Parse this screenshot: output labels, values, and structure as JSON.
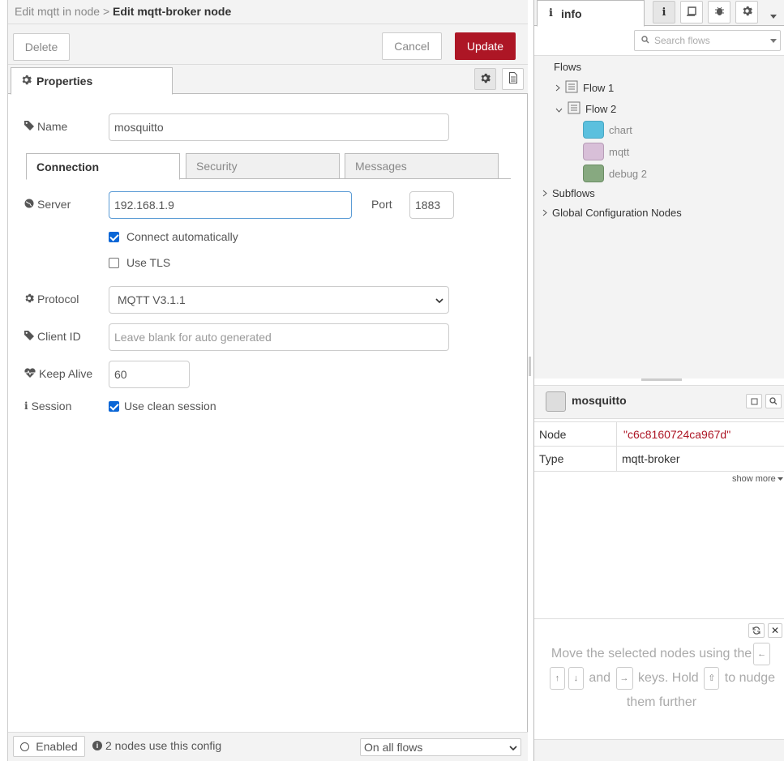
{
  "editor": {
    "breadcrumb_parent": "Edit mqtt in node",
    "breadcrumb_sep": ">",
    "title": "Edit mqtt-broker node",
    "delete_label": "Delete",
    "cancel_label": "Cancel",
    "update_label": "Update",
    "properties_tab": "Properties",
    "name_label": "Name",
    "name_value": "mosquitto",
    "subtabs": [
      "Connection",
      "Security",
      "Messages"
    ],
    "server_label": "Server",
    "server_value": "192.168.1.9",
    "port_label": "Port",
    "port_value": "1883",
    "connect_auto_label": "Connect automatically",
    "connect_auto_checked": true,
    "use_tls_label": "Use TLS",
    "use_tls_checked": false,
    "protocol_label": "Protocol",
    "protocol_value": "MQTT V3.1.1",
    "client_id_label": "Client ID",
    "client_id_placeholder": "Leave blank for auto generated",
    "keepalive_label": "Keep Alive",
    "keepalive_value": "60",
    "session_label": "Session",
    "clean_session_label": "Use clean session",
    "clean_session_checked": true,
    "enabled_label": "Enabled",
    "usage_text": "2 nodes use this config",
    "scope_value": "On all flows",
    "accent_color": "#ad1625"
  },
  "sidebar": {
    "tab_label": "info",
    "search_placeholder": "Search flows",
    "flows_label": "Flows",
    "flow1": "Flow 1",
    "flow2": "Flow 2",
    "nodes": [
      {
        "label": "chart",
        "color": "#5bc0de"
      },
      {
        "label": "mqtt",
        "color": "#d8bfd8"
      },
      {
        "label": "debug 2",
        "color": "#87a980"
      }
    ],
    "subflows_label": "Subflows",
    "global_config_label": "Global Configuration Nodes",
    "selected_name": "mosquitto",
    "node_key": "Node",
    "node_value": "\"c6c8160724ca967d\"",
    "type_key": "Type",
    "type_value": "mqtt-broker",
    "show_more": "show more",
    "tip_part1": "Move the selected nodes using the",
    "tip_and": "and",
    "tip_keys": "keys. Hold",
    "tip_nudge": "to nudge",
    "tip_further": "them further"
  }
}
